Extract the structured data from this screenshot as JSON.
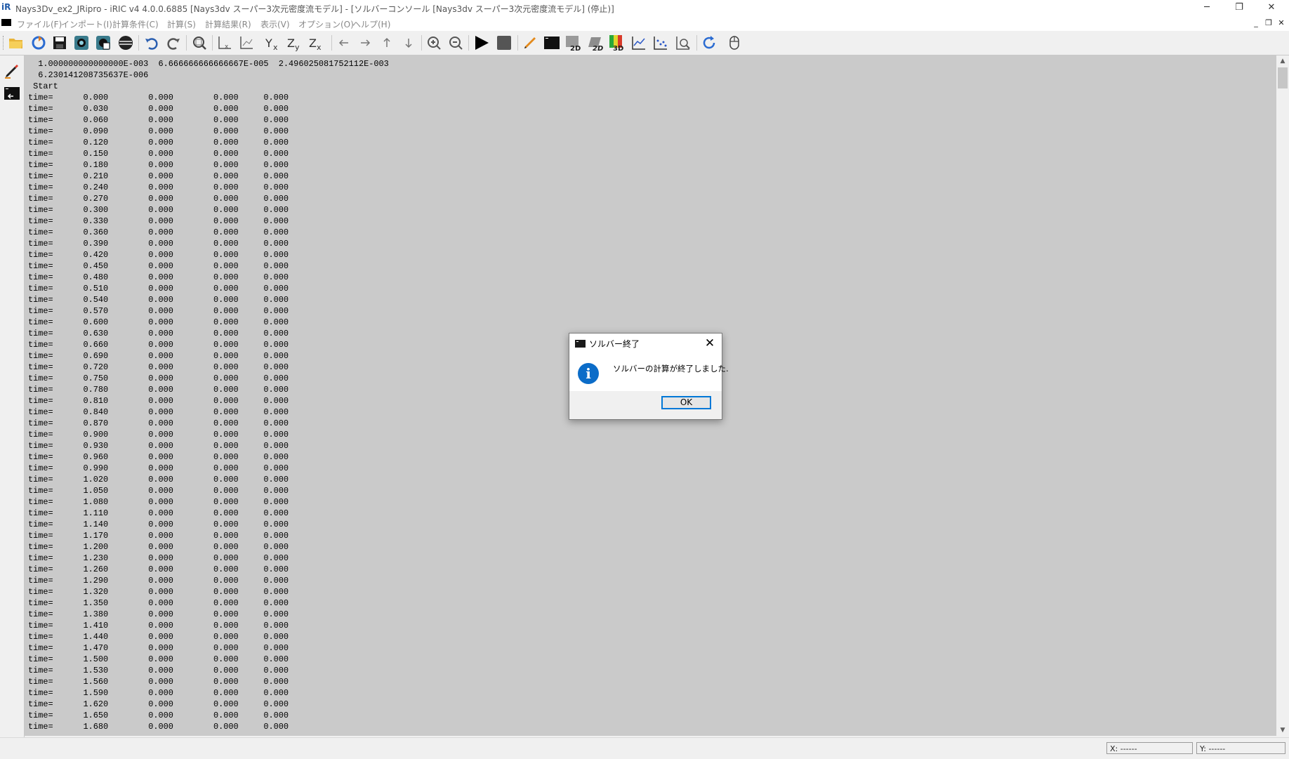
{
  "window": {
    "title": "Nays3Dv_ex2_JRipro - iRIC v4 4.0.0.6885 [Nays3dv スーパー3次元密度流モデル] - [ソルバーコンソール [Nays3dv スーパー3次元密度流モデル] (停止)]",
    "minimize": "─",
    "restore": "❐",
    "close": "✕"
  },
  "menu": {
    "items": [
      "ファイル(F)",
      "インポート(I)",
      "計算条件(C)",
      "計算(S)",
      "計算結果(R)",
      "表示(V)",
      "オプション(O)",
      "ヘルプ(H)"
    ],
    "mdi_minimize": "_",
    "mdi_restore": "❐",
    "mdi_close": "✕"
  },
  "toolbar": {
    "accent_play": "#000000",
    "icons": [
      "open-folder",
      "reload",
      "save",
      "snapshot",
      "snapshot-alt",
      "sphere",
      "undo",
      "redo",
      "zoom-fit",
      "axis-x",
      "axis-xy",
      "axis-yx",
      "axis-zy",
      "axis-zx",
      "arrow-left",
      "arrow-right",
      "arrow-up",
      "arrow-down",
      "zoom-in",
      "zoom-out",
      "run",
      "stop",
      "pencil",
      "console",
      "window-2d",
      "window-2d-bird",
      "window-3d",
      "graph",
      "scattered-graph",
      "profile",
      "refresh",
      "mouse"
    ]
  },
  "console": {
    "header_lines": [
      "  1.000000000000000E-003  6.666666666666667E-005  2.496025081752112E-003",
      "  6.230141208735637E-006",
      " Start"
    ],
    "row_label": "time=",
    "rows": [
      [
        "0.000",
        "0.000",
        "0.000",
        "0.000"
      ],
      [
        "0.030",
        "0.000",
        "0.000",
        "0.000"
      ],
      [
        "0.060",
        "0.000",
        "0.000",
        "0.000"
      ],
      [
        "0.090",
        "0.000",
        "0.000",
        "0.000"
      ],
      [
        "0.120",
        "0.000",
        "0.000",
        "0.000"
      ],
      [
        "0.150",
        "0.000",
        "0.000",
        "0.000"
      ],
      [
        "0.180",
        "0.000",
        "0.000",
        "0.000"
      ],
      [
        "0.210",
        "0.000",
        "0.000",
        "0.000"
      ],
      [
        "0.240",
        "0.000",
        "0.000",
        "0.000"
      ],
      [
        "0.270",
        "0.000",
        "0.000",
        "0.000"
      ],
      [
        "0.300",
        "0.000",
        "0.000",
        "0.000"
      ],
      [
        "0.330",
        "0.000",
        "0.000",
        "0.000"
      ],
      [
        "0.360",
        "0.000",
        "0.000",
        "0.000"
      ],
      [
        "0.390",
        "0.000",
        "0.000",
        "0.000"
      ],
      [
        "0.420",
        "0.000",
        "0.000",
        "0.000"
      ],
      [
        "0.450",
        "0.000",
        "0.000",
        "0.000"
      ],
      [
        "0.480",
        "0.000",
        "0.000",
        "0.000"
      ],
      [
        "0.510",
        "0.000",
        "0.000",
        "0.000"
      ],
      [
        "0.540",
        "0.000",
        "0.000",
        "0.000"
      ],
      [
        "0.570",
        "0.000",
        "0.000",
        "0.000"
      ],
      [
        "0.600",
        "0.000",
        "0.000",
        "0.000"
      ],
      [
        "0.630",
        "0.000",
        "0.000",
        "0.000"
      ],
      [
        "0.660",
        "0.000",
        "0.000",
        "0.000"
      ],
      [
        "0.690",
        "0.000",
        "0.000",
        "0.000"
      ],
      [
        "0.720",
        "0.000",
        "0.000",
        "0.000"
      ],
      [
        "0.750",
        "0.000",
        "0.000",
        "0.000"
      ],
      [
        "0.780",
        "0.000",
        "0.000",
        "0.000"
      ],
      [
        "0.810",
        "0.000",
        "0.000",
        "0.000"
      ],
      [
        "0.840",
        "0.000",
        "0.000",
        "0.000"
      ],
      [
        "0.870",
        "0.000",
        "0.000",
        "0.000"
      ],
      [
        "0.900",
        "0.000",
        "0.000",
        "0.000"
      ],
      [
        "0.930",
        "0.000",
        "0.000",
        "0.000"
      ],
      [
        "0.960",
        "0.000",
        "0.000",
        "0.000"
      ],
      [
        "0.990",
        "0.000",
        "0.000",
        "0.000"
      ],
      [
        "1.020",
        "0.000",
        "0.000",
        "0.000"
      ],
      [
        "1.050",
        "0.000",
        "0.000",
        "0.000"
      ],
      [
        "1.080",
        "0.000",
        "0.000",
        "0.000"
      ],
      [
        "1.110",
        "0.000",
        "0.000",
        "0.000"
      ],
      [
        "1.140",
        "0.000",
        "0.000",
        "0.000"
      ],
      [
        "1.170",
        "0.000",
        "0.000",
        "0.000"
      ],
      [
        "1.200",
        "0.000",
        "0.000",
        "0.000"
      ],
      [
        "1.230",
        "0.000",
        "0.000",
        "0.000"
      ],
      [
        "1.260",
        "0.000",
        "0.000",
        "0.000"
      ],
      [
        "1.290",
        "0.000",
        "0.000",
        "0.000"
      ],
      [
        "1.320",
        "0.000",
        "0.000",
        "0.000"
      ],
      [
        "1.350",
        "0.000",
        "0.000",
        "0.000"
      ],
      [
        "1.380",
        "0.000",
        "0.000",
        "0.000"
      ],
      [
        "1.410",
        "0.000",
        "0.000",
        "0.000"
      ],
      [
        "1.440",
        "0.000",
        "0.000",
        "0.000"
      ],
      [
        "1.470",
        "0.000",
        "0.000",
        "0.000"
      ],
      [
        "1.500",
        "0.000",
        "0.000",
        "0.000"
      ],
      [
        "1.530",
        "0.000",
        "0.000",
        "0.000"
      ],
      [
        "1.560",
        "0.000",
        "0.000",
        "0.000"
      ],
      [
        "1.590",
        "0.000",
        "0.000",
        "0.000"
      ],
      [
        "1.620",
        "0.000",
        "0.000",
        "0.000"
      ],
      [
        "1.650",
        "0.000",
        "0.000",
        "0.000"
      ],
      [
        "1.680",
        "0.000",
        "0.000",
        "0.000"
      ]
    ],
    "background": "#cacaca"
  },
  "scrollbar": {
    "up": "▲",
    "down": "▼"
  },
  "status": {
    "x": "X: ------",
    "y": "Y: ------"
  },
  "dialog": {
    "title": "ソルバー終了",
    "message": "ソルバーの計算が終了しました.",
    "info_glyph": "i",
    "close": "✕",
    "ok": "OK",
    "accent": "#0078d7"
  }
}
